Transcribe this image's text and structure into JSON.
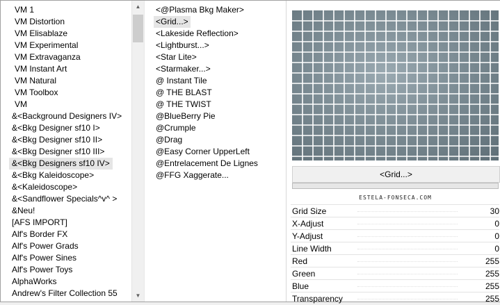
{
  "left_list": {
    "items": [
      {
        "label": "VM 1",
        "sub": true
      },
      {
        "label": "VM Distortion",
        "sub": true
      },
      {
        "label": "VM Elisablaze",
        "sub": true
      },
      {
        "label": "VM Experimental",
        "sub": true
      },
      {
        "label": "VM Extravaganza",
        "sub": true
      },
      {
        "label": "VM Instant Art",
        "sub": true
      },
      {
        "label": "VM Natural",
        "sub": true
      },
      {
        "label": "VM Toolbox",
        "sub": true
      },
      {
        "label": "VM",
        "sub": true
      },
      {
        "label": "&<Background Designers IV>",
        "sub": false
      },
      {
        "label": "&<Bkg Designer sf10 I>",
        "sub": false
      },
      {
        "label": "&<Bkg Designer sf10 II>",
        "sub": false
      },
      {
        "label": "&<Bkg Designer sf10 III>",
        "sub": false
      },
      {
        "label": "&<Bkg Designers sf10 IV>",
        "sub": false,
        "selected": true
      },
      {
        "label": "&<Bkg Kaleidoscope>",
        "sub": false
      },
      {
        "label": "&<Kaleidoscope>",
        "sub": false
      },
      {
        "label": "&<Sandflower Specials^v^ >",
        "sub": false
      },
      {
        "label": "&Neu!",
        "sub": false
      },
      {
        "label": "[AFS IMPORT]",
        "sub": false
      },
      {
        "label": "Alf's Border FX",
        "sub": false
      },
      {
        "label": "Alf's Power Grads",
        "sub": false
      },
      {
        "label": "Alf's Power Sines",
        "sub": false
      },
      {
        "label": "Alf's Power Toys",
        "sub": false
      },
      {
        "label": "AlphaWorks",
        "sub": false
      },
      {
        "label": "Andrew's Filter Collection 55",
        "sub": false
      }
    ],
    "scroll_up_icon": "▲",
    "scroll_down_icon": "▼"
  },
  "mid_list": {
    "items": [
      {
        "label": "<@Plasma Bkg Maker>"
      },
      {
        "label": "<Grid...>",
        "selected": true
      },
      {
        "label": "<Lakeside Reflection>"
      },
      {
        "label": "<Lightburst...>"
      },
      {
        "label": "<Star Lite>"
      },
      {
        "label": "<Starmaker...>"
      },
      {
        "label": "@ Instant Tile"
      },
      {
        "label": "@ THE BLAST"
      },
      {
        "label": "@ THE TWIST"
      },
      {
        "label": "@BlueBerry Pie"
      },
      {
        "label": "@Crumple"
      },
      {
        "label": "@Drag"
      },
      {
        "label": "@Easy Corner UpperLeft"
      },
      {
        "label": "@Entrelacement De Lignes"
      },
      {
        "label": "@FFG Xaggerate..."
      }
    ]
  },
  "preview": {
    "grid_color": "#ffffff",
    "bg_color": "#7d8d95"
  },
  "filter_button": {
    "label": "<Grid...>"
  },
  "progress": {
    "fraction": 0
  },
  "credit": {
    "text": "ESTELA-FONSECA.COM"
  },
  "params": [
    {
      "label": "Grid Size",
      "value": "30"
    },
    {
      "label": "X-Adjust",
      "value": "0"
    },
    {
      "label": "Y-Adjust",
      "value": "0"
    },
    {
      "label": "Line Width",
      "value": "0"
    },
    {
      "label": "Red",
      "value": "255"
    },
    {
      "label": "Green",
      "value": "255"
    },
    {
      "label": "Blue",
      "value": "255"
    },
    {
      "label": "Transparency",
      "value": "255"
    }
  ]
}
